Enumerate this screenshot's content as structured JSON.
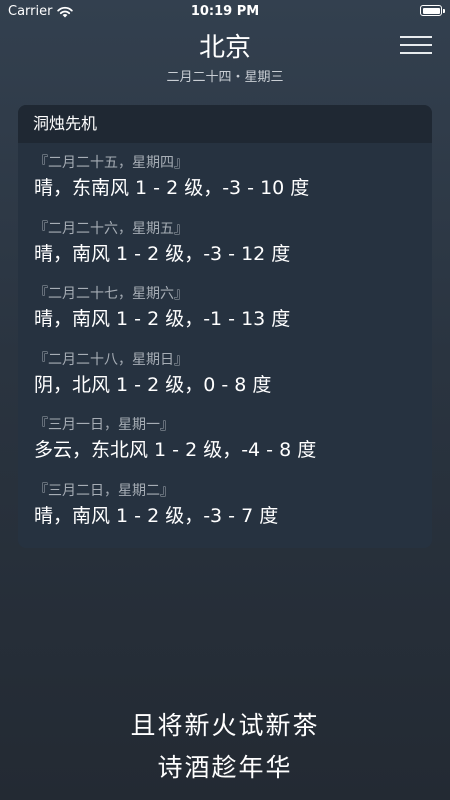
{
  "status_bar": {
    "carrier": "Carrier",
    "time": "10:19 PM"
  },
  "header": {
    "city": "北京",
    "date_line": "二月二十四・星期三"
  },
  "forecast": {
    "title": "洞烛先机",
    "days": [
      {
        "day": "『二月二十五，星期四』",
        "weather": "晴，东南风 1 - 2 级，-3 - 10 度"
      },
      {
        "day": "『二月二十六，星期五』",
        "weather": "晴，南风 1 - 2 级，-3 - 12 度"
      },
      {
        "day": "『二月二十七，星期六』",
        "weather": "晴，南风 1 - 2 级，-1 - 13 度"
      },
      {
        "day": "『二月二十八，星期日』",
        "weather": "阴，北风 1 - 2 级，0 - 8 度"
      },
      {
        "day": "『三月一日，星期一』",
        "weather": "多云，东北风 1 - 2 级，-4 - 8 度"
      },
      {
        "day": "『三月二日，星期二』",
        "weather": "晴，南风 1 - 2 级，-3 - 7 度"
      }
    ]
  },
  "poem": {
    "line1": "且将新火试新茶",
    "line2": "诗酒趁年华"
  },
  "icons": {
    "wifi": "wifi-icon",
    "battery": "battery-icon",
    "menu": "hamburger-menu-icon"
  }
}
